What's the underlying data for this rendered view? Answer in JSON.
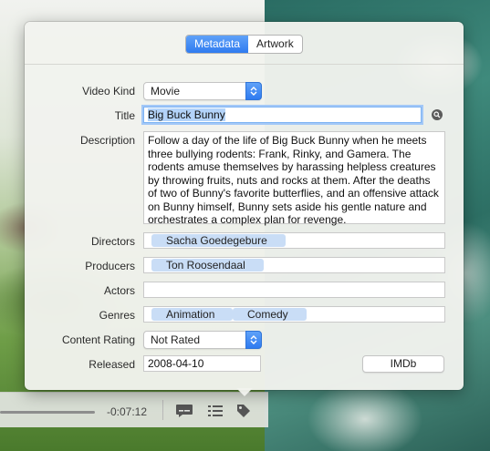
{
  "tabs": [
    {
      "label": "Metadata",
      "active": true
    },
    {
      "label": "Artwork",
      "active": false
    }
  ],
  "form": {
    "video_kind": {
      "label": "Video Kind",
      "value": "Movie"
    },
    "title": {
      "label": "Title",
      "value": "Big Buck Bunny"
    },
    "description": {
      "label": "Description",
      "value": "Follow a day of the life of Big Buck Bunny when he meets three bullying rodents: Frank, Rinky, and Gamera. The rodents amuse themselves by harassing helpless creatures by throwing fruits, nuts and rocks at them. After the deaths of two of Bunny's favorite butterflies, and an offensive attack on Bunny himself, Bunny sets aside his gentle nature and orchestrates a complex plan for revenge."
    },
    "directors": {
      "label": "Directors",
      "tokens": [
        "Sacha Goedegebure"
      ]
    },
    "producers": {
      "label": "Producers",
      "tokens": [
        "Ton Roosendaal"
      ]
    },
    "actors": {
      "label": "Actors",
      "tokens": []
    },
    "genres": {
      "label": "Genres",
      "tokens": [
        "Animation",
        "Comedy"
      ]
    },
    "content_rating": {
      "label": "Content Rating",
      "value": "Not Rated"
    },
    "released": {
      "label": "Released",
      "value": "2008-04-10"
    },
    "imdb_button": "IMDb"
  },
  "player": {
    "remaining_time": "-0:07:12",
    "icons": [
      "subtitles-icon",
      "chapters-list-icon",
      "tag-icon"
    ]
  },
  "colors": {
    "accent": "#2f7bf0",
    "token_bg": "#c9ddf6",
    "focus_ring": "#a3c8f7"
  }
}
